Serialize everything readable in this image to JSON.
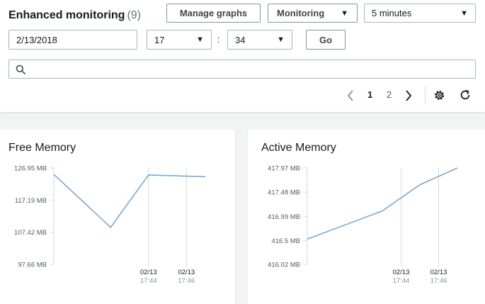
{
  "header": {
    "title": "Enhanced monitoring",
    "count": "(9)",
    "manage_graphs_label": "Manage graphs",
    "monitoring_label": "Monitoring",
    "interval_value": "5 minutes"
  },
  "time_filter": {
    "date_value": "2/13/2018",
    "hour_value": "17",
    "separator": ":",
    "minute_value": "34",
    "go_label": "Go"
  },
  "search": {
    "placeholder": "",
    "value": ""
  },
  "pagination": {
    "pages": [
      "1",
      "2"
    ],
    "current_page": "1"
  },
  "icons": {
    "search": "search-icon",
    "prev": "chevron-left-icon",
    "next": "chevron-right-icon",
    "settings": "gear-icon",
    "refresh": "refresh-icon",
    "dropdown": "caret-down-icon"
  },
  "colors": {
    "line": "#7aa8d1",
    "grid": "#d5dbdb",
    "axis_text": "#545b64"
  },
  "chart_data": [
    {
      "type": "line",
      "title": "Free Memory",
      "y_unit": "MB",
      "yticks": [
        97.66,
        107.42,
        117.19,
        126.95
      ],
      "ytick_labels": [
        "97.66 MB",
        "107.42 MB",
        "117.19 MB",
        "126.95 MB"
      ],
      "ylim": [
        97.66,
        126.95
      ],
      "xlim": [
        "17:39",
        "17:47"
      ],
      "xticks": [
        {
          "date": "02/13",
          "time": "17:44"
        },
        {
          "date": "02/13",
          "time": "17:46"
        }
      ],
      "x": [
        "17:39",
        "17:42",
        "17:44",
        "17:47"
      ],
      "series": [
        {
          "values": [
            125.0,
            108.9,
            124.8,
            124.3
          ]
        }
      ]
    },
    {
      "type": "line",
      "title": "Active Memory",
      "y_unit": "MB",
      "yticks": [
        416.02,
        416.5,
        416.99,
        417.48,
        417.97
      ],
      "ytick_labels": [
        "416.02 MB",
        "416.5 MB",
        "416.99 MB",
        "417.48 MB",
        "417.97 MB"
      ],
      "ylim": [
        416.02,
        417.97
      ],
      "xlim": [
        "17:39",
        "17:47"
      ],
      "xticks": [
        {
          "date": "02/13",
          "time": "17:44"
        },
        {
          "date": "02/13",
          "time": "17:46"
        }
      ],
      "x": [
        "17:39",
        "17:43",
        "17:45",
        "17:47"
      ],
      "series": [
        {
          "values": [
            416.53,
            417.1,
            417.63,
            417.97
          ]
        }
      ]
    }
  ]
}
